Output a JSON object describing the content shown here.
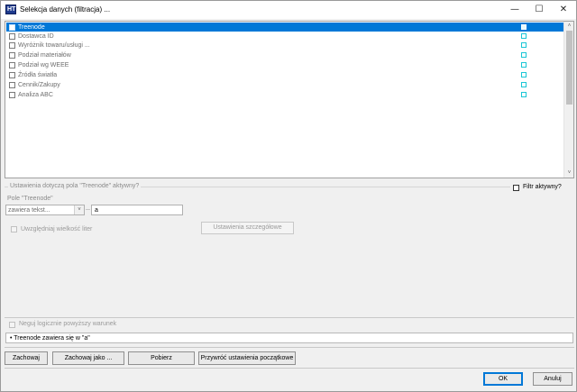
{
  "window": {
    "title": "Selekcja danych (filtracja) ...",
    "icon": "app-icon",
    "icon_text": "HT",
    "controls": {
      "minimize": "—",
      "maximize": "☐",
      "close": "✕"
    }
  },
  "list": {
    "items": [
      {
        "label": "Treenode",
        "selected": true
      },
      {
        "label": "Dostawca ID",
        "selected": false
      },
      {
        "label": "Wyróżnik towaru/usługi ...",
        "selected": false
      },
      {
        "label": "Podział materiałów",
        "selected": false
      },
      {
        "label": "Podział wg WEEE",
        "selected": false
      },
      {
        "label": "Źródła światła",
        "selected": false
      },
      {
        "label": "Cennik/Zakupy",
        "selected": false
      },
      {
        "label": "Analiza ABC",
        "selected": false
      }
    ],
    "marker_color": "#19c6d6",
    "selection_color": "#0078d7",
    "scroll_up": "˄",
    "scroll_down": "˅"
  },
  "settings": {
    "group_caption": "Ustawienia dotyczą pola \"Treenode\" aktywny?",
    "filter_active_label": "Filtr aktywny?",
    "field_caption": "Pole \"Treenode\"",
    "operator_value": "zawiera tekst...",
    "operator_arrow": "˅",
    "text_value": "a",
    "case_sensitive_label": "Uwzględniaj wielkość liter",
    "detail_settings_label": "Ustawienia szczegółowe",
    "negate_label": "Neguj logicznie powyższy warunek"
  },
  "summary": {
    "text": "• Treenode zawiera się w \"a\""
  },
  "actions": {
    "save": "Zachowaj",
    "save_as": "Zachowaj jako ...",
    "load": "Pobierz",
    "restore": "Przywróć ustawienia początkowe"
  },
  "dialog": {
    "ok": "OK",
    "cancel": "Anuluj"
  }
}
